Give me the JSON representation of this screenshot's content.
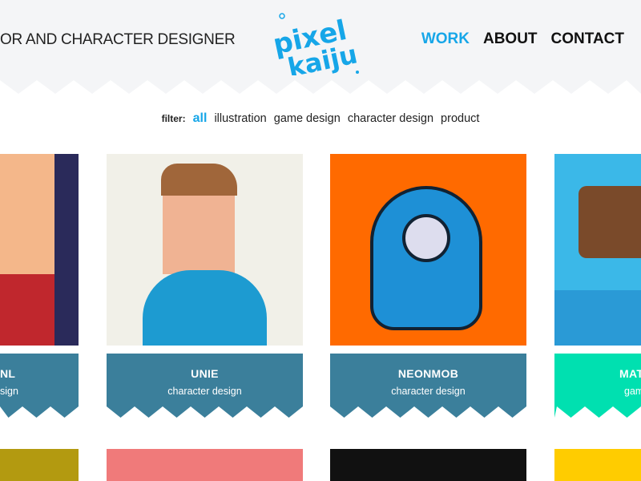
{
  "header": {
    "tagline": "OR AND CHARACTER DESIGNER",
    "logo_text": "pixel kaiju",
    "nav": [
      {
        "label": "WORK",
        "active": true
      },
      {
        "label": "ABOUT"
      },
      {
        "label": "CONTACT"
      }
    ]
  },
  "filter": {
    "label": "filter:",
    "options": [
      "all",
      "illustration",
      "game design",
      "character design",
      "product"
    ],
    "active": "all"
  },
  "colors": {
    "accent": "#16a6e8",
    "caption": "#3b7f9b",
    "caption_alt": "#00e0b0",
    "header_bg": "#f4f5f7"
  },
  "cards": [
    {
      "title": "NL",
      "category": "sign",
      "caption_color": "#3b7f9b",
      "image_bg": "#c0392b"
    },
    {
      "title": "UNIE",
      "category": "character design",
      "caption_color": "#3b7f9b",
      "image_bg": "#f1f0e8"
    },
    {
      "title": "NEONMOB",
      "category": "character design",
      "caption_color": "#3b7f9b",
      "image_bg": "#ff6a00"
    },
    {
      "title": "MAT",
      "category": "gam",
      "caption_color": "#00e0b0",
      "image_bg": "#3bb8e8"
    }
  ],
  "row2_bgs": [
    "#b39a10",
    "#f07a7a",
    "#111111",
    "#ffcc00"
  ]
}
